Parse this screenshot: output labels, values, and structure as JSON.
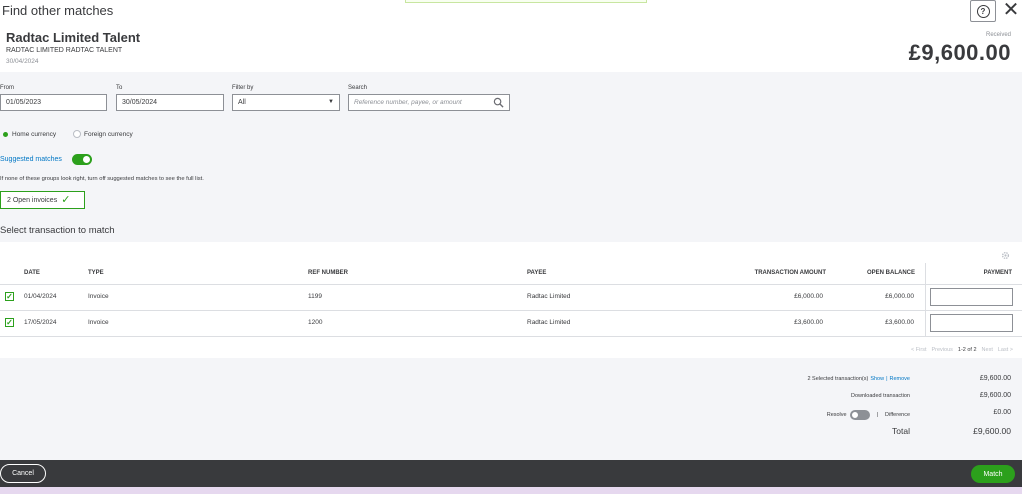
{
  "dialog": {
    "title": "Find other matches"
  },
  "summary": {
    "payee": "Radtac Limited Talent",
    "payee_sub": "RADTAC LIMITED RADTAC TALENT",
    "date": "30/04/2024",
    "received_label": "Received",
    "amount": "£9,600.00"
  },
  "filters": {
    "from_label": "From",
    "from_value": "01/05/2023",
    "to_label": "To",
    "to_value": "30/05/2024",
    "filter_label": "Filter by",
    "filter_value": "All",
    "search_label": "Search",
    "search_placeholder": "Reference number, payee, or amount"
  },
  "currency": {
    "home": "Home currency",
    "foreign": "Foreign currency"
  },
  "suggested": {
    "label": "Suggested matches",
    "hint": "If none of these groups look right, turn off suggested matches to see the full list.",
    "group_label": "2 Open invoices"
  },
  "section_title": "Select transaction to match",
  "table": {
    "headers": [
      "DATE",
      "TYPE",
      "REF NUMBER",
      "PAYEE",
      "TRANSACTION AMOUNT",
      "OPEN BALANCE",
      "PAYMENT"
    ],
    "rows": [
      {
        "date": "01/04/2024",
        "type": "Invoice",
        "ref": "1199",
        "payee": "Radtac Limited",
        "amount": "£6,000.00",
        "open": "£6,000.00"
      },
      {
        "date": "17/05/2024",
        "type": "Invoice",
        "ref": "1200",
        "payee": "Radtac Limited",
        "amount": "£3,600.00",
        "open": "£3,600.00"
      }
    ]
  },
  "pager": {
    "first": "< First",
    "previous": "Previous",
    "range": "1-2 of 2",
    "next": "Next",
    "last": "Last >"
  },
  "totals": {
    "selected": "2 Selected transaction(s)",
    "show": "Show",
    "sep": "|",
    "remove": "Remove",
    "selected_value": "£9,600.00",
    "downloaded": "Downloaded transaction",
    "downloaded_value": "£9,600.00",
    "resolve": "Resolve",
    "difference": "Difference",
    "difference_value": "£0.00",
    "total": "Total",
    "total_value": "£9,600.00"
  },
  "footer": {
    "cancel": "Cancel",
    "match": "Match"
  },
  "colors": {
    "accent": "#2ca01c",
    "link": "#0077c5",
    "footer": "#393a3d"
  }
}
